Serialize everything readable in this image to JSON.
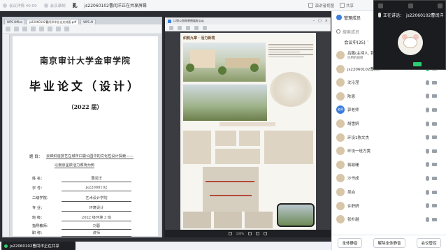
{
  "topbar": {
    "items": [
      "会议详情 40:09",
      "会议录制"
    ],
    "app_glyph": "乿",
    "sharer": "js22060102曹闰洋正在共享屏幕",
    "right_items": [
      "演讲者视图",
      "共享"
    ]
  },
  "doc_window": {
    "tabs": [
      "WPS Office",
      "js22060102曹闰洋毕业论文封面.pdf",
      "WPS AI"
    ],
    "university": "南京审计大学金审学院",
    "thesis_title": "毕业论文（设计）",
    "year": "（2022 届）",
    "topic_label": "题 目：",
    "topic_line1": "云锦织造技艺在城市口袋公园中的文化性设计探索——",
    "topic_line2": "以南京星辰活力照场为例",
    "fields": [
      {
        "label": "姓 名：",
        "value": "曹闰洋"
      },
      {
        "label": "学 号：",
        "value": "js22060102"
      },
      {
        "label": "二级学院：",
        "value": "艺术设计学院"
      },
      {
        "label": "专 业：",
        "value": "环境设计"
      },
      {
        "label": "班 级：",
        "value": "2022 级环境 3 班"
      },
      {
        "label": "指导教师：",
        "value": "刘蓉"
      },
      {
        "label": "职 称：",
        "value": "讲师"
      }
    ]
  },
  "image_window": {
    "title": "口袋公园效果图展板.jpg",
    "poster_title": "织韵九章 · 活力新境",
    "zoom": "100%"
  },
  "share_banner": "js22060102曹闰洋正在共享",
  "panel": {
    "title": "管理成员",
    "search_placeholder": "搜索成员",
    "meeting_tab": "会议中(25)",
    "members": [
      {
        "name": "吕鹏(主持人, 我)",
        "sub": "已用的组织",
        "avatar": "",
        "blue": false
      },
      {
        "name": "js22060102曹闰洋",
        "sub": "",
        "avatar": "",
        "blue": false
      },
      {
        "name": "沈沁滢",
        "sub": "",
        "avatar": "",
        "blue": false
      },
      {
        "name": "陈恩",
        "sub": "",
        "avatar": "",
        "blue": false
      },
      {
        "name": "郭老师",
        "sub": "",
        "avatar": "老师",
        "blue": true
      },
      {
        "name": "胡雪妍",
        "sub": "",
        "avatar": "",
        "blue": false
      },
      {
        "name": "环设1陈文杰",
        "sub": "",
        "avatar": "",
        "blue": false
      },
      {
        "name": "环设一班方雯",
        "sub": "",
        "avatar": "",
        "blue": false
      },
      {
        "name": "蒋颖珊",
        "sub": "",
        "avatar": "",
        "blue": false
      },
      {
        "name": "沙书成",
        "sub": "",
        "avatar": "",
        "blue": false
      },
      {
        "name": "吴焱",
        "sub": "",
        "avatar": "",
        "blue": false
      },
      {
        "name": "许舒妍",
        "sub": "",
        "avatar": "",
        "blue": false
      },
      {
        "name": "张朴越",
        "sub": "",
        "avatar": "",
        "blue": false
      }
    ],
    "buttons": [
      "全体静音",
      "解除全体静音",
      "会议管控"
    ]
  },
  "speaker": {
    "label": "正在讲话：",
    "name": "js22060102曹闰洋"
  }
}
